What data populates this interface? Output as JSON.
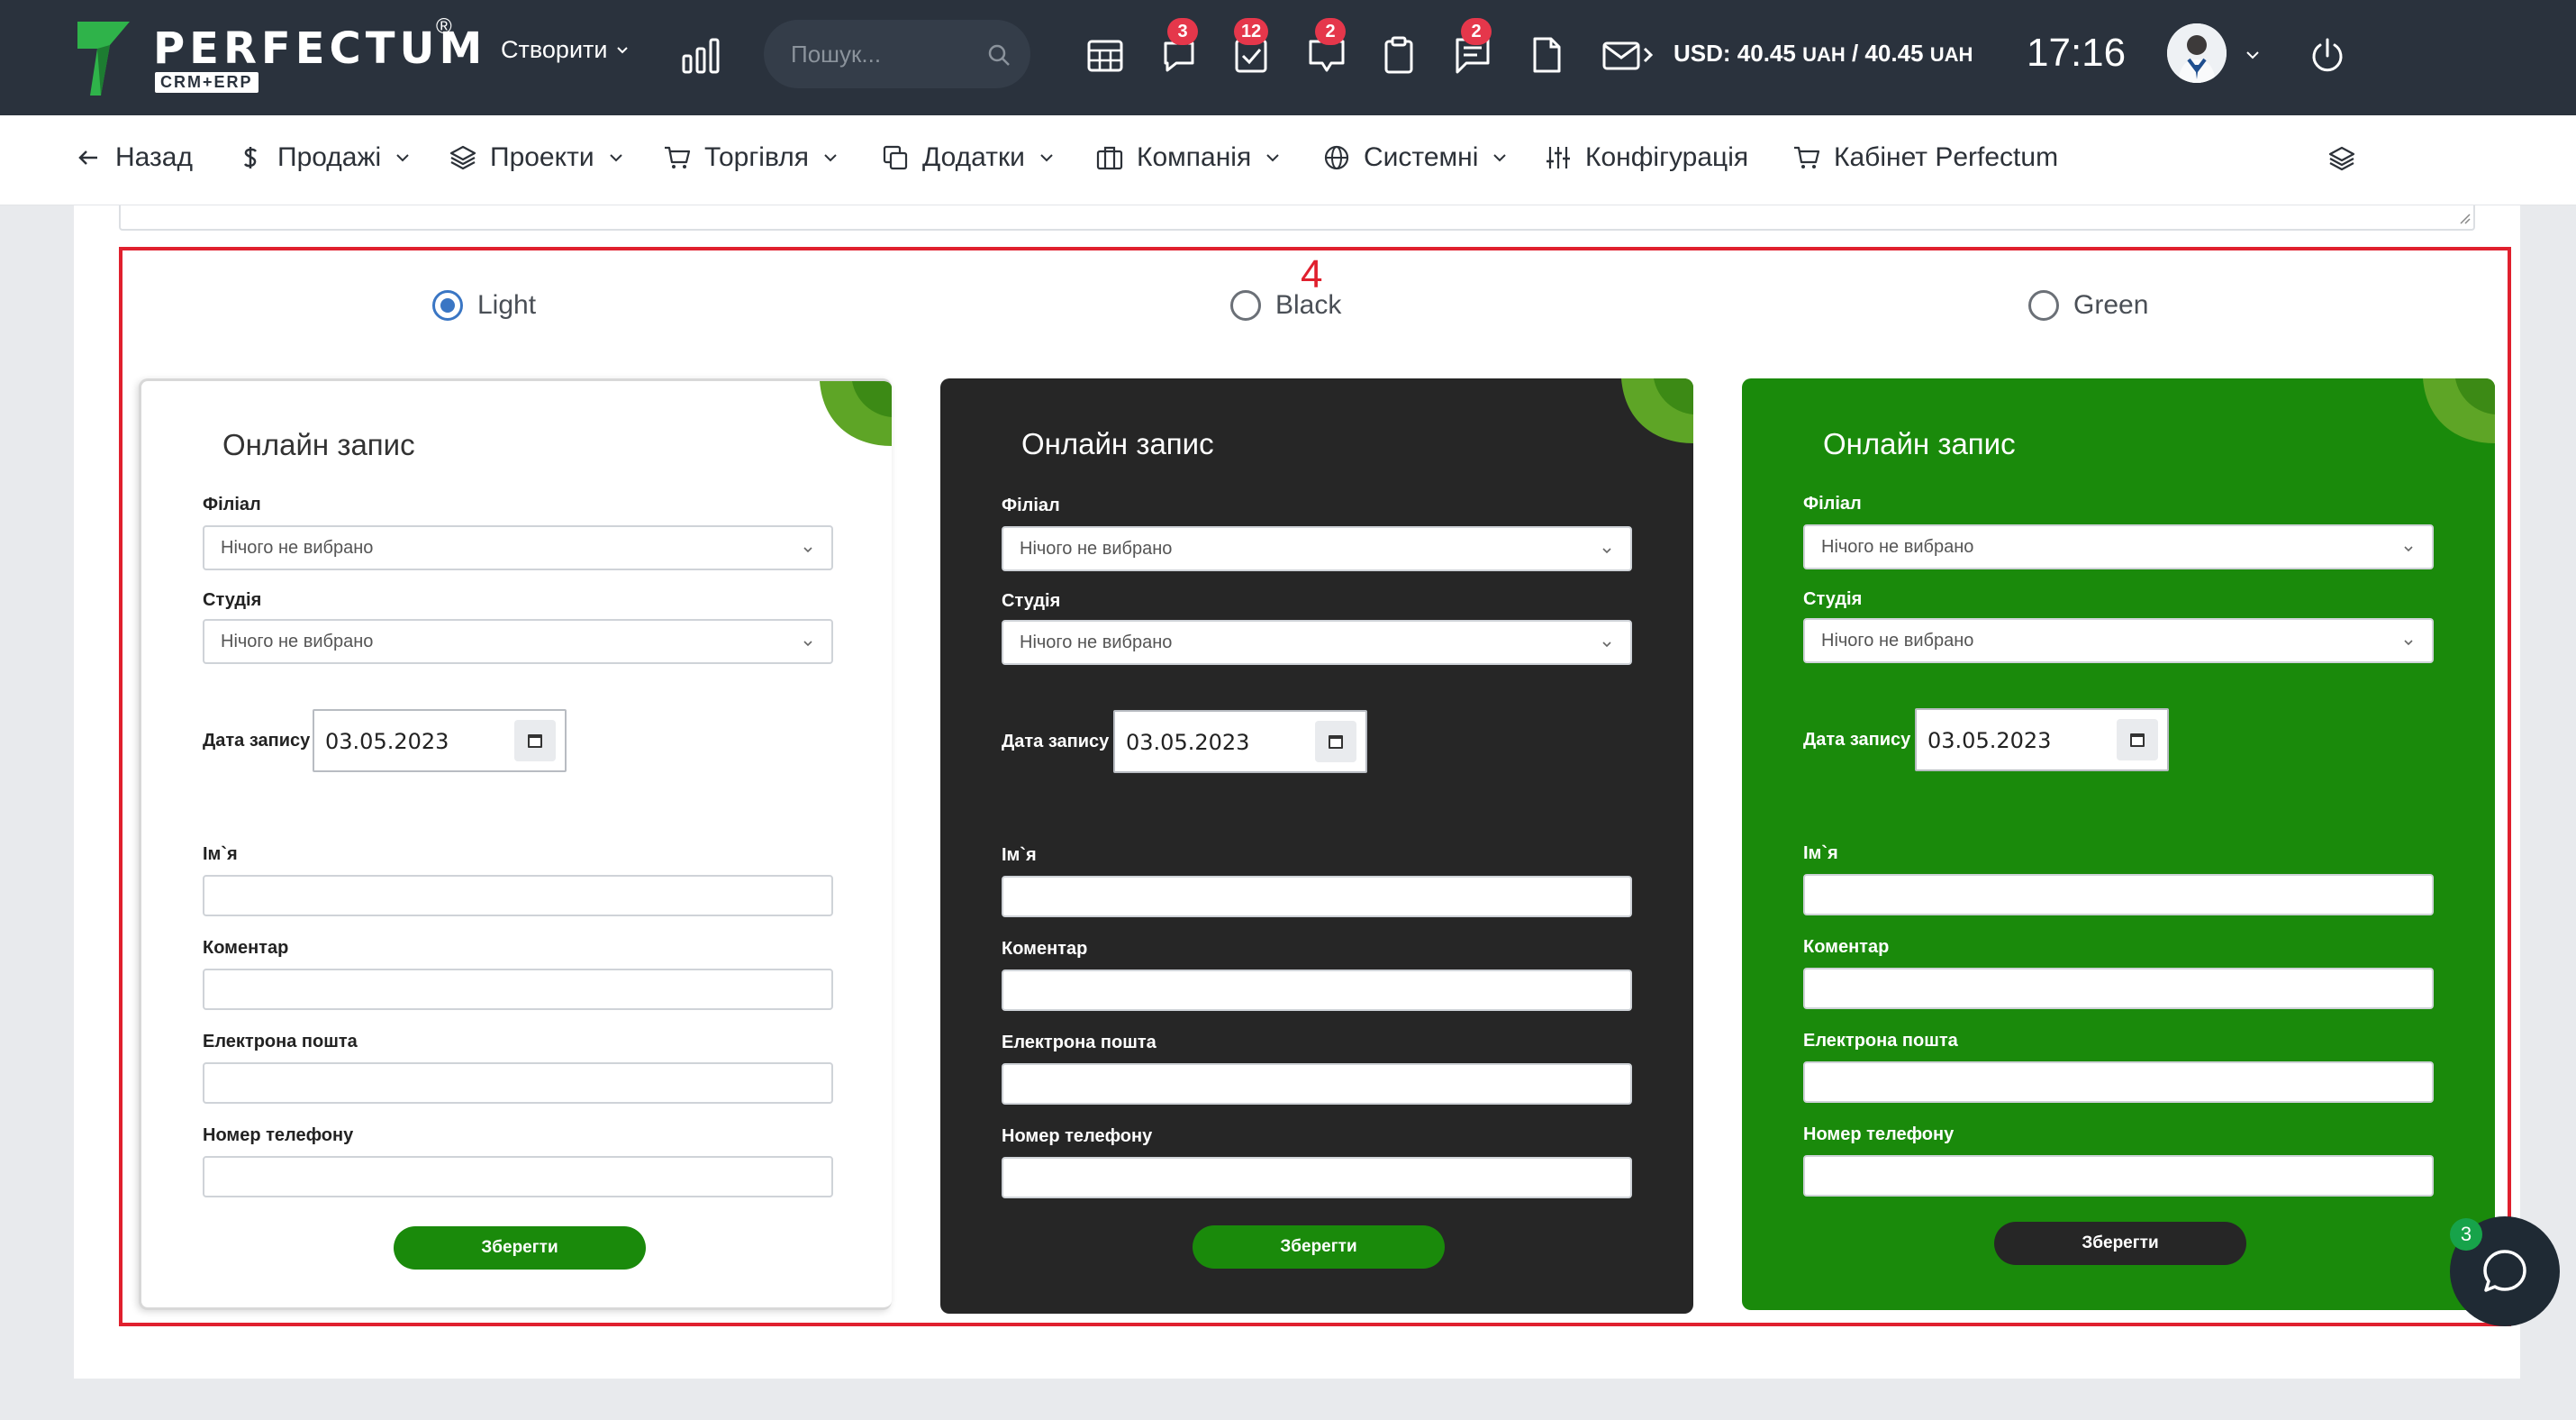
{
  "brand": {
    "name": "PERFECTUM",
    "registered": "®",
    "sub": "CRM+ERP"
  },
  "topbar": {
    "create_label": "Створити",
    "search_placeholder": "Пошук...",
    "badges": {
      "chat": "3",
      "tasks": "12",
      "comments": "2",
      "messages": "2"
    },
    "currency": {
      "prefix": "USD: 40.45 ",
      "unit1": "UAH",
      "mid": " / 40.45 ",
      "unit2": "UAH"
    },
    "time": "17:16"
  },
  "nav": {
    "back": "Назад",
    "sales": "Продажі",
    "projects": "Проекти",
    "trade": "Торгівля",
    "addons": "Додатки",
    "company": "Компанія",
    "system": "Системні",
    "config": "Конфігурація",
    "cabinet": "Кабінет Perfectum"
  },
  "step_number": "4",
  "themes": {
    "selected": "light",
    "options": [
      {
        "id": "light",
        "label": "Light"
      },
      {
        "id": "black",
        "label": "Black"
      },
      {
        "id": "green",
        "label": "Green"
      }
    ]
  },
  "form": {
    "title": "Онлайн запис",
    "branch_label": "Філіал",
    "branch_value": "Нічого не вибрано",
    "studio_label": "Студія",
    "studio_value": "Нічого не вибрано",
    "date_label": "Дата запису",
    "date_value": "03.05.2023",
    "name_label": "Ім`я",
    "comment_label": "Коментар",
    "email_label": "Електрона пошта",
    "phone_label": "Номер телефону",
    "save_label": "Зберегти"
  },
  "chat_badge": "3",
  "colors": {
    "topbar": "#2a323d",
    "accent_green": "#1a8a0b",
    "dark_card": "#262626",
    "highlight": "#e0202e",
    "badge": "#e5374b"
  }
}
